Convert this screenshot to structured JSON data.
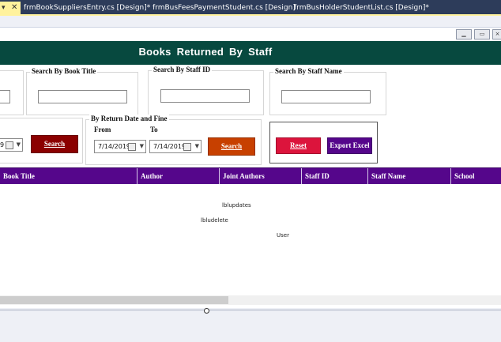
{
  "ide": {
    "tabs": [
      {
        "label": "frmBookSuppliersEntry.cs [Design]*"
      },
      {
        "label": "frmBusFeesPaymentStudent.cs [Design]"
      },
      {
        "label": "frmBusHolderStudentList.cs [Design]*"
      }
    ]
  },
  "form": {
    "header_title": "Books  Returned  By Staff",
    "groups": {
      "book_title": {
        "label": "Search By Book Title"
      },
      "staff_id": {
        "label": "Search By Staff ID"
      },
      "staff_name": {
        "label": "Search By Staff Name"
      },
      "return_date": {
        "label": "By Return Date and Fine",
        "from_label": "From",
        "to_label": "To",
        "from_date": "7/14/2019",
        "to_date": "7/14/2019",
        "search_label": "Search"
      },
      "left_partial": {
        "date_fragment": "9",
        "search_label": "Search"
      }
    },
    "reset_label": "Reset",
    "export_label": "Export Excel",
    "grid": {
      "columns": [
        "Book Title",
        "Author",
        "Joint Authors",
        "Staff ID",
        "Staff Name",
        "School"
      ]
    },
    "component_tray": [
      "lblupdates",
      "lbludelete",
      "User"
    ],
    "colors": {
      "header_bg": "#07493f",
      "grid_header_bg": "#55068b",
      "search_dark_red": "#8b0000",
      "search_orange": "#c74000",
      "reset_red": "#dc143c",
      "export_purple": "#55068b"
    }
  }
}
